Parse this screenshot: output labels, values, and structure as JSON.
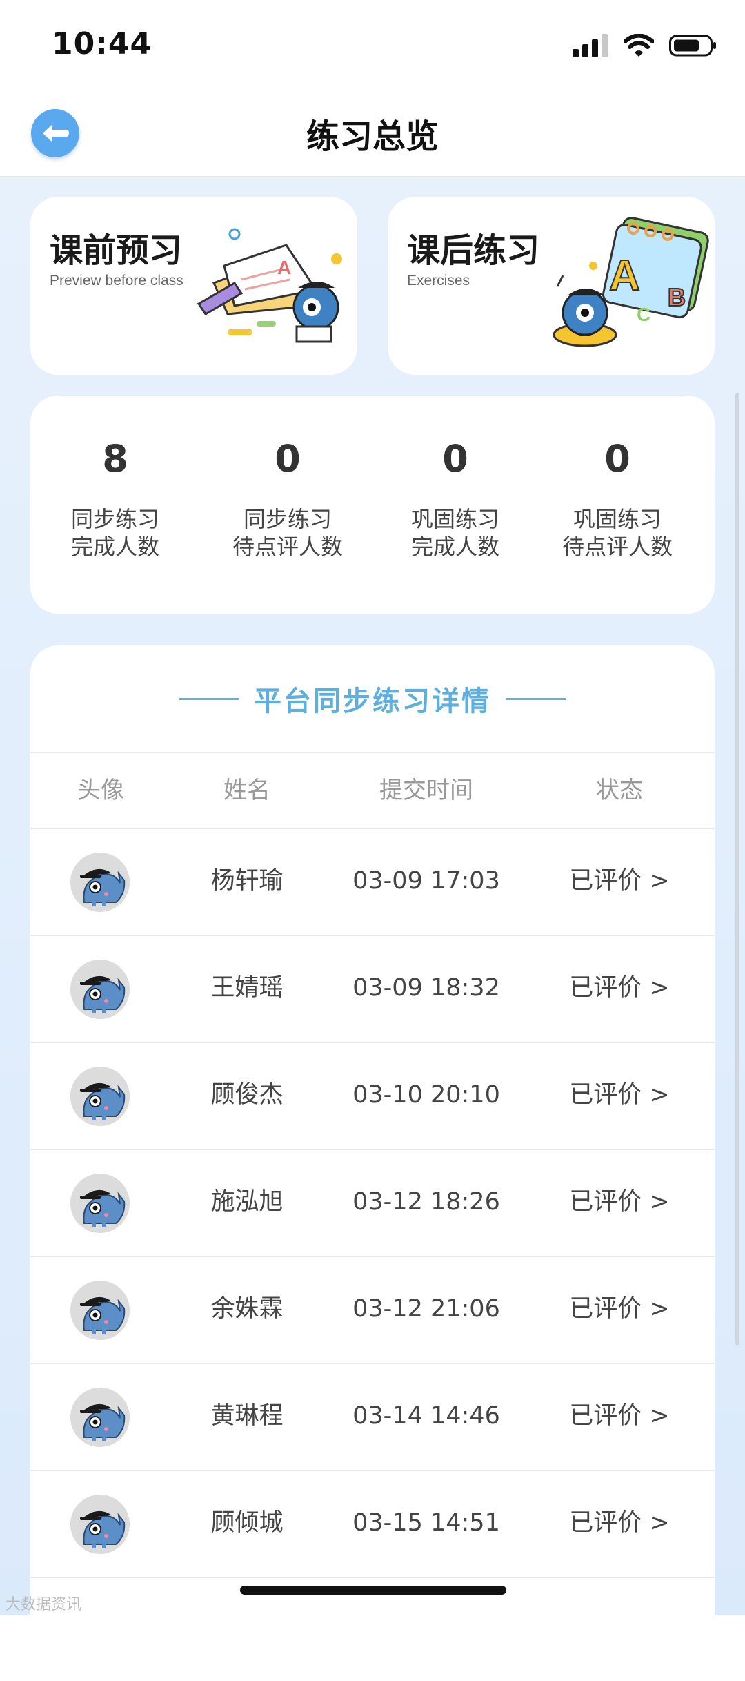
{
  "status_bar": {
    "time": "10:44"
  },
  "header": {
    "title": "练习总览"
  },
  "entries": [
    {
      "title": "课前预习",
      "subtitle": "Preview before class"
    },
    {
      "title": "课后练习",
      "subtitle": "Exercises"
    }
  ],
  "stats": [
    {
      "value": "8",
      "label_line1": "同步练习",
      "label_line2": "完成人数"
    },
    {
      "value": "0",
      "label_line1": "同步练习",
      "label_line2": "待点评人数"
    },
    {
      "value": "0",
      "label_line1": "巩固练习",
      "label_line2": "完成人数"
    },
    {
      "value": "0",
      "label_line1": "巩固练习",
      "label_line2": "待点评人数"
    }
  ],
  "details": {
    "title": "平台同步练习详情",
    "columns": [
      "头像",
      "姓名",
      "提交时间",
      "状态"
    ],
    "rows": [
      {
        "name": "杨轩瑜",
        "time": "03-09 17:03",
        "status": "已评价 >"
      },
      {
        "name": "王婧瑶",
        "time": "03-09 18:32",
        "status": "已评价 >"
      },
      {
        "name": "顾俊杰",
        "time": "03-10 20:10",
        "status": "已评价 >"
      },
      {
        "name": "施泓旭",
        "time": "03-12 18:26",
        "status": "已评价 >"
      },
      {
        "name": "余姝霖",
        "time": "03-12 21:06",
        "status": "已评价 >"
      },
      {
        "name": "黄琳程",
        "time": "03-14 14:46",
        "status": "已评价 >"
      },
      {
        "name": "顾倾城",
        "time": "03-15 14:51",
        "status": "已评价 >"
      }
    ]
  },
  "watermark": "大数据资讯",
  "colors": {
    "accent": "#5dafdf",
    "back_button": "#5aa9ee",
    "page_bg": "#e3effc"
  },
  "icons": [
    "back-arrow-icon",
    "signal-icon",
    "wifi-icon",
    "battery-icon",
    "chevron-right-icon"
  ]
}
